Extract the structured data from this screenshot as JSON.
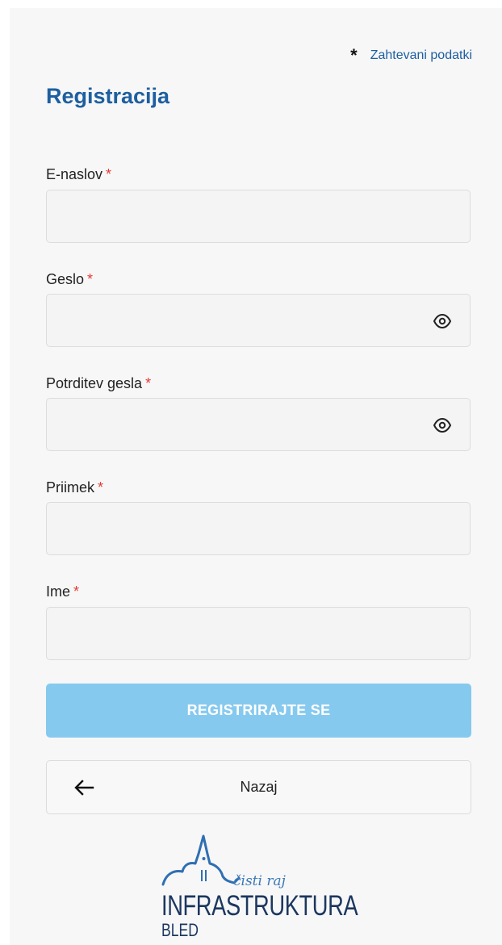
{
  "required_note": "Zahtevani podatki",
  "required_marker": "*",
  "title": "Registracija",
  "fields": [
    {
      "label": "E-naslov",
      "value": "",
      "type": "email",
      "has_eye": false
    },
    {
      "label": "Geslo",
      "value": "",
      "type": "password",
      "has_eye": true
    },
    {
      "label": "Potrditev gesla",
      "value": "",
      "type": "password",
      "has_eye": true
    },
    {
      "label": "Priimek",
      "value": "",
      "type": "text",
      "has_eye": false
    },
    {
      "label": "Ime",
      "value": "",
      "type": "text",
      "has_eye": false
    }
  ],
  "submit_label": "REGISTRIRAJTE SE",
  "back_label": "Nazaj",
  "logo": {
    "tagline": "čisti raj",
    "brand": "INFRASTRUKTURA",
    "sub": "BLED"
  },
  "icons": {
    "required": "asterisk-icon",
    "show_password": "eye-icon",
    "back": "arrow-left-icon"
  },
  "colors": {
    "accent": "#1d5fa0",
    "required": "#e53935",
    "submit_bg": "#86c9ef",
    "logo_dark": "#1c3760",
    "logo_light": "#3a78b7"
  }
}
